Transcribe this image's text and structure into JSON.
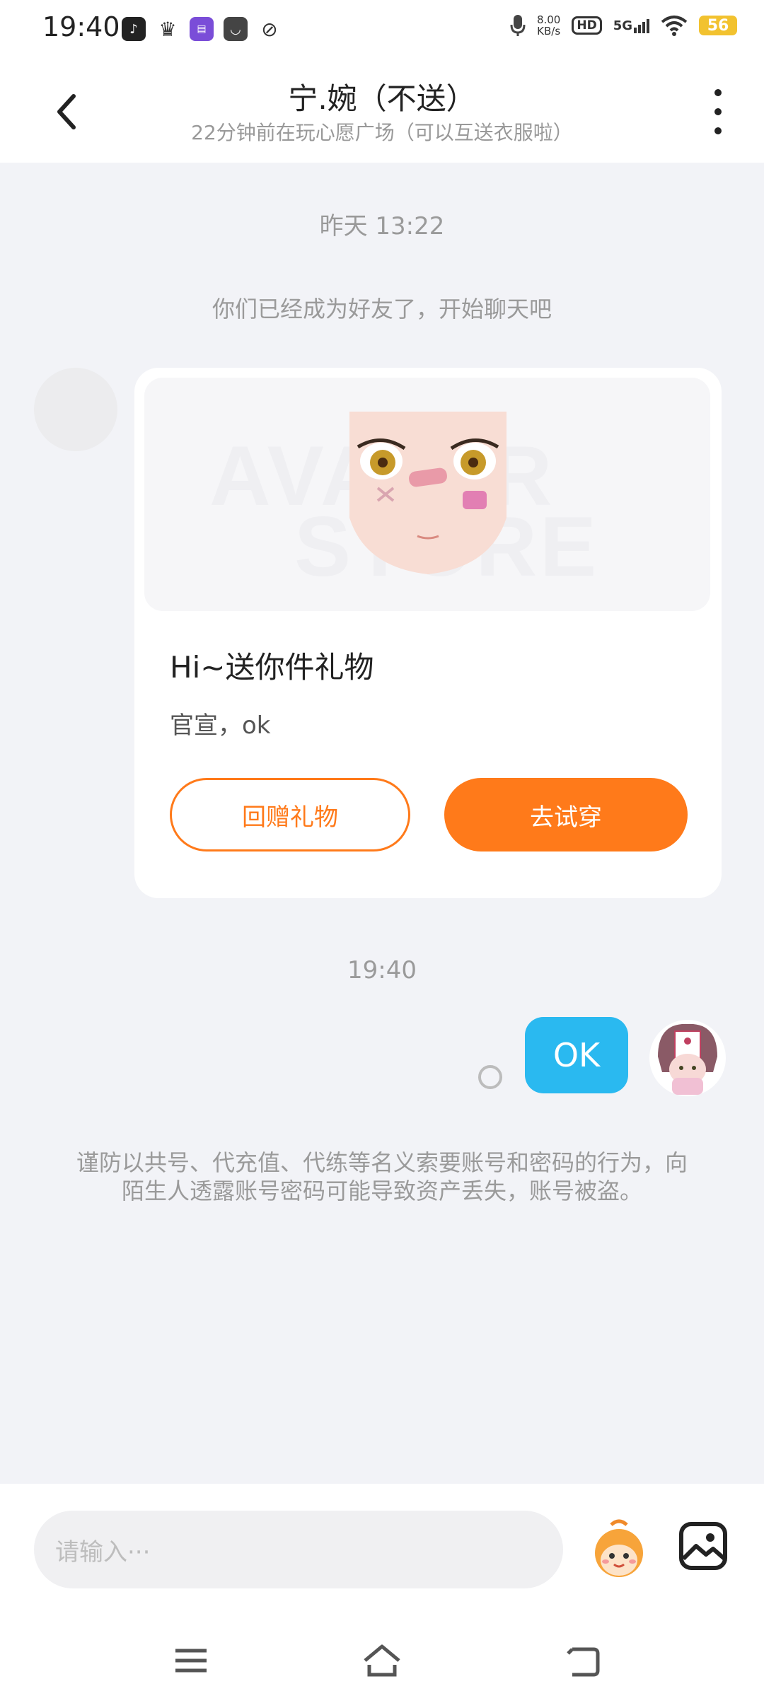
{
  "status_bar": {
    "time": "19:40",
    "app_icons": [
      "tiktok-icon",
      "crown-icon",
      "news-icon",
      "bag-icon",
      "swirl-icon"
    ],
    "network_speed": "8.00",
    "network_unit": "KB/s",
    "hd_label": "HD",
    "signal_label": "5G",
    "battery": "56"
  },
  "header": {
    "title": "宁.婉（不送）",
    "subtitle": "22分钟前在玩心愿广场（可以互送衣服啦）"
  },
  "chat": {
    "time_1": "昨天 13:22",
    "system_message": "你们已经成为好友了，开始聊天吧",
    "gift_card": {
      "watermark_line1": "AVATAR",
      "watermark_line2": "STORE",
      "title": "Hi~送你件礼物",
      "description": "官宣，ok",
      "return_button": "回赠礼物",
      "try_button": "去试穿"
    },
    "time_2": "19:40",
    "my_message": "OK",
    "warning": "谨防以共号、代充值、代练等名义索要账号和密码的行为，向陌生人透露账号密码可能导致资产丢失，账号被盗。"
  },
  "input": {
    "placeholder": "请输入···"
  },
  "colors": {
    "accent": "#ff7a1a",
    "bubble": "#2ab9f0",
    "background": "#f2f3f7"
  }
}
